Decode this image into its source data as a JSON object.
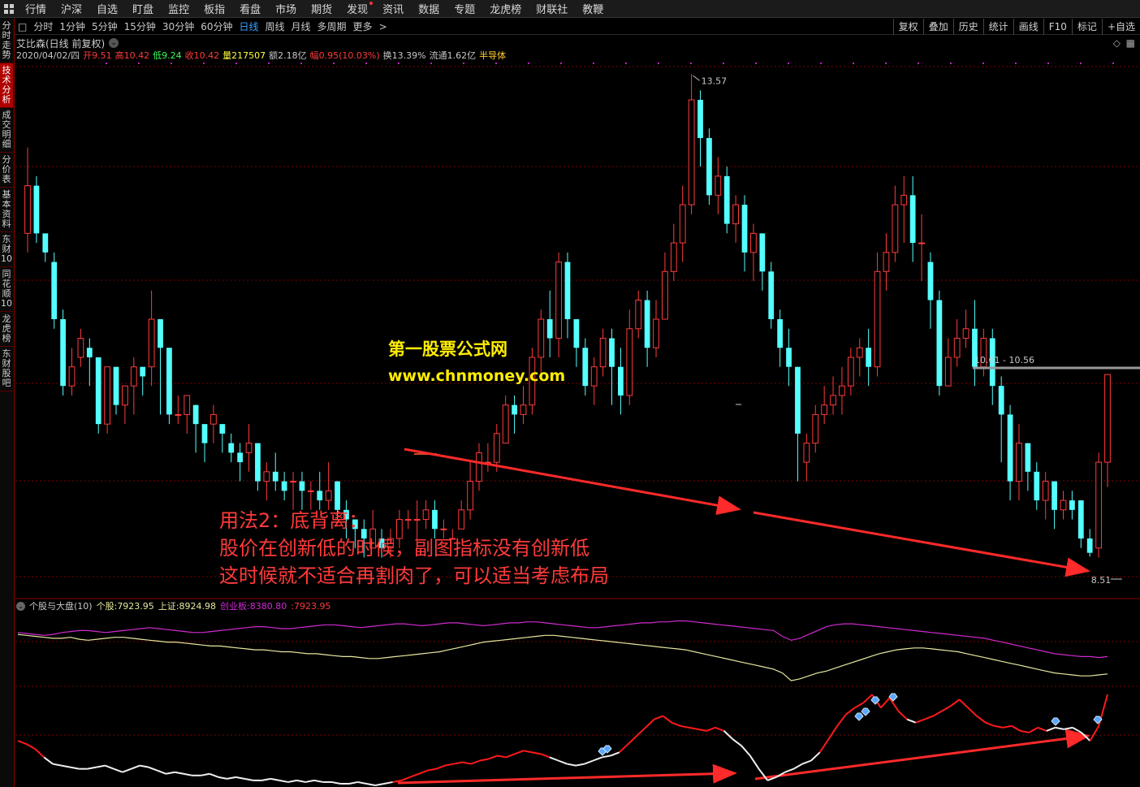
{
  "nav": {
    "items": [
      "行情",
      "沪深",
      "自选",
      "盯盘",
      "监控",
      "板指",
      "看盘",
      "市场",
      "期货",
      "发现",
      "资讯",
      "数据",
      "专题",
      "龙虎榜",
      "财联社",
      "教鞭"
    ]
  },
  "periods": {
    "items": [
      "分时",
      "1分钟",
      "5分钟",
      "15分钟",
      "30分钟",
      "60分钟",
      "日线",
      "周线",
      "月线",
      "多周期",
      "更多"
    ],
    "active": "日线"
  },
  "toolbar": {
    "items": [
      "复权",
      "叠加",
      "历史",
      "统计",
      "画线",
      "F10",
      "标记",
      "+自选"
    ]
  },
  "sidebar": {
    "items": [
      "分时走势",
      "技术分析",
      "成交明细",
      "分价表",
      "基本资料",
      "东财10",
      "同花顺10",
      "龙虎榜",
      "东财股吧"
    ],
    "active": "技术分析"
  },
  "stock": {
    "title": "艾比森(日线 前复权)",
    "date": "2020/04/02/四",
    "open_label": "开",
    "open": "9.51",
    "high_label": "高",
    "high": "10.42",
    "low_label": "低",
    "low": "9.24",
    "close_label": "收",
    "close": "10.42",
    "vol_label": "量",
    "vol": "217507",
    "amt_label": "额",
    "amt": "2.18亿",
    "chg_label": "幅",
    "chg": "0.95(10.03%)",
    "turn_label": "换",
    "turn": "13.39%",
    "float_label": "流通",
    "float": "1.62亿",
    "sector": "半导体"
  },
  "annotations": {
    "high_label": "13.57",
    "low_label": "8.51",
    "range_label": "10.61 - 10.56"
  },
  "watermark": {
    "line1": "第一股票公式网",
    "line2": "www.chnmoney.com"
  },
  "note": {
    "line1": "用法2：底背离：",
    "line2": "股价在创新低的时候，副图指标没有创新低",
    "line3": "这时候就不适合再割肉了，可以适当考虑布局"
  },
  "indicator": {
    "name": "个股与大盘(10)",
    "stock_label": "个股:",
    "stock_value": "7923.95",
    "sz_label": "上证:",
    "sz_value": "8924.98",
    "cyb_label": "创业板:",
    "cyb_value": "8380.80",
    "extra": ":7923.95"
  },
  "colors": {
    "up": "#ff3b3b",
    "down": "#54ffff",
    "grid": "#7a0000",
    "magenta": "#d02ad0",
    "yellow": "#e8e8a0",
    "note": "#ff3a3a",
    "arrow": "#ff2a2a"
  },
  "chart_data": {
    "type": "candlestick",
    "price_range": [
      8.51,
      13.57
    ],
    "candles": [
      [
        11.9,
        12.4,
        12.8,
        11.7
      ],
      [
        12.4,
        11.9,
        12.5,
        11.8
      ],
      [
        11.9,
        11.7,
        11.8,
        11.6
      ],
      [
        11.6,
        11.0,
        11.7,
        10.9
      ],
      [
        11.0,
        10.3,
        11.1,
        10.2
      ],
      [
        10.3,
        10.5,
        10.7,
        10.2
      ],
      [
        10.6,
        10.8,
        10.9,
        10.5
      ],
      [
        10.7,
        10.6,
        10.8,
        10.3
      ],
      [
        10.6,
        9.9,
        10.6,
        9.8
      ],
      [
        9.9,
        10.5,
        10.5,
        9.8
      ],
      [
        10.5,
        10.1,
        10.5,
        10.0
      ],
      [
        10.1,
        10.3,
        10.3,
        9.9
      ],
      [
        10.3,
        10.5,
        10.6,
        10.0
      ],
      [
        10.5,
        10.4,
        10.5,
        10.2
      ],
      [
        10.5,
        11.0,
        11.3,
        10.3
      ],
      [
        11.0,
        10.7,
        11.0,
        10.0
      ],
      [
        10.7,
        10.0,
        10.7,
        9.9
      ],
      [
        10.0,
        10.0,
        10.2,
        9.9
      ],
      [
        10.0,
        10.2,
        10.2,
        9.8
      ],
      [
        10.1,
        9.9,
        10.1,
        9.6
      ],
      [
        9.9,
        9.7,
        9.9,
        9.5
      ],
      [
        9.9,
        10.0,
        10.1,
        9.7
      ],
      [
        9.9,
        9.8,
        9.9,
        9.6
      ],
      [
        9.7,
        9.6,
        9.8,
        9.5
      ],
      [
        9.6,
        9.5,
        9.7,
        9.3
      ],
      [
        9.6,
        9.7,
        9.9,
        9.4
      ],
      [
        9.7,
        9.3,
        9.7,
        9.2
      ],
      [
        9.3,
        9.4,
        9.5,
        9.1
      ],
      [
        9.4,
        9.3,
        9.6,
        9.2
      ],
      [
        9.3,
        9.2,
        9.4,
        9.1
      ],
      [
        9.3,
        9.3,
        9.4,
        9.0
      ],
      [
        9.3,
        9.2,
        9.4,
        9.0
      ],
      [
        9.2,
        9.2,
        9.3,
        9.0
      ],
      [
        9.2,
        9.1,
        9.4,
        9.0
      ],
      [
        9.1,
        9.2,
        9.5,
        9.0
      ],
      [
        9.3,
        9.0,
        9.3,
        8.9
      ],
      [
        9.0,
        8.9,
        9.1,
        8.7
      ],
      [
        8.9,
        8.8,
        8.9,
        8.6
      ],
      [
        8.8,
        8.7,
        8.9,
        8.5
      ],
      [
        8.6,
        8.8,
        9.0,
        8.6
      ],
      [
        8.7,
        8.6,
        8.8,
        8.5
      ],
      [
        8.6,
        8.7,
        8.8,
        8.5
      ],
      [
        8.7,
        8.9,
        9.0,
        8.6
      ],
      [
        8.9,
        8.9,
        9.0,
        8.8
      ],
      [
        8.9,
        8.9,
        9.1,
        8.6
      ],
      [
        8.9,
        9.0,
        9.1,
        8.8
      ],
      [
        9.0,
        8.8,
        9.1,
        8.7
      ],
      [
        8.8,
        8.8,
        8.9,
        8.7
      ],
      [
        8.7,
        8.7,
        8.8,
        8.7
      ],
      [
        8.8,
        9.0,
        9.1,
        8.8
      ],
      [
        9.0,
        9.3,
        9.5,
        8.9
      ],
      [
        9.3,
        9.6,
        9.7,
        9.2
      ],
      [
        9.5,
        9.5,
        9.7,
        9.4
      ],
      [
        9.5,
        9.8,
        9.9,
        9.4
      ],
      [
        9.7,
        10.1,
        10.2,
        9.7
      ],
      [
        10.1,
        10.0,
        10.2,
        9.8
      ],
      [
        10.0,
        10.1,
        10.3,
        9.9
      ],
      [
        10.1,
        10.6,
        10.7,
        10.0
      ],
      [
        10.6,
        11.0,
        11.1,
        10.4
      ],
      [
        11.0,
        10.8,
        11.3,
        10.6
      ],
      [
        10.8,
        11.6,
        11.7,
        10.6
      ],
      [
        11.6,
        11.0,
        11.7,
        10.8
      ],
      [
        11.0,
        10.7,
        11.0,
        10.5
      ],
      [
        10.7,
        10.3,
        10.8,
        10.2
      ],
      [
        10.3,
        10.5,
        10.6,
        10.1
      ],
      [
        10.5,
        10.8,
        10.9,
        10.4
      ],
      [
        10.8,
        10.5,
        10.9,
        10.1
      ],
      [
        10.5,
        10.2,
        10.7,
        10.0
      ],
      [
        10.2,
        10.9,
        11.1,
        10.1
      ],
      [
        10.9,
        11.2,
        11.3,
        10.8
      ],
      [
        11.2,
        10.7,
        11.3,
        10.5
      ],
      [
        10.7,
        11.0,
        11.2,
        10.6
      ],
      [
        11.0,
        11.5,
        11.7,
        11.0
      ],
      [
        11.5,
        11.8,
        12.0,
        11.4
      ],
      [
        11.8,
        12.2,
        12.4,
        11.6
      ],
      [
        12.2,
        13.3,
        13.57,
        12.1
      ],
      [
        13.3,
        12.9,
        13.4,
        12.6
      ],
      [
        12.9,
        12.3,
        13.0,
        12.2
      ],
      [
        12.3,
        12.5,
        12.7,
        12.1
      ],
      [
        12.5,
        12.0,
        12.6,
        11.9
      ],
      [
        12.0,
        12.2,
        12.3,
        11.8
      ],
      [
        12.2,
        11.7,
        12.3,
        11.5
      ],
      [
        11.7,
        11.9,
        12.0,
        11.4
      ],
      [
        11.9,
        11.5,
        11.9,
        11.3
      ],
      [
        11.5,
        11.0,
        11.6,
        10.9
      ],
      [
        11.0,
        10.7,
        11.1,
        10.5
      ],
      [
        10.7,
        10.5,
        10.9,
        10.3
      ],
      [
        10.5,
        9.8,
        10.5,
        9.3
      ],
      [
        9.5,
        9.7,
        9.8,
        9.3
      ],
      [
        9.7,
        10.0,
        10.1,
        9.6
      ],
      [
        10.0,
        10.1,
        10.3,
        9.9
      ],
      [
        10.1,
        10.2,
        10.4,
        10.0
      ],
      [
        10.2,
        10.3,
        10.5,
        10.0
      ],
      [
        10.3,
        10.6,
        10.7,
        10.2
      ],
      [
        10.6,
        10.7,
        10.8,
        10.4
      ],
      [
        10.7,
        10.5,
        10.9,
        10.3
      ],
      [
        10.5,
        11.5,
        11.7,
        10.4
      ],
      [
        11.5,
        11.7,
        11.9,
        11.3
      ],
      [
        11.7,
        12.2,
        12.4,
        11.6
      ],
      [
        12.2,
        12.3,
        12.5,
        11.8
      ],
      [
        12.3,
        11.8,
        12.5,
        11.6
      ],
      [
        11.8,
        11.8,
        12.1,
        11.4
      ],
      [
        11.6,
        11.2,
        11.7,
        10.9
      ],
      [
        11.2,
        10.3,
        11.3,
        10.2
      ],
      [
        10.3,
        10.6,
        10.8,
        10.3
      ],
      [
        10.6,
        10.8,
        11.0,
        10.5
      ],
      [
        10.8,
        10.9,
        11.1,
        10.7
      ],
      [
        10.9,
        10.5,
        11.2,
        10.3
      ],
      [
        10.5,
        10.8,
        10.9,
        10.4
      ],
      [
        10.8,
        10.3,
        10.9,
        10.1
      ],
      [
        10.3,
        10.0,
        10.4,
        9.5
      ],
      [
        10.0,
        9.3,
        10.1,
        9.1
      ],
      [
        9.3,
        9.7,
        9.9,
        9.1
      ],
      [
        9.7,
        9.4,
        9.7,
        9.2
      ],
      [
        9.4,
        9.1,
        9.5,
        9.0
      ],
      [
        9.1,
        9.3,
        9.4,
        8.9
      ],
      [
        9.3,
        9.0,
        9.3,
        8.8
      ],
      [
        9.0,
        9.1,
        9.2,
        8.9
      ],
      [
        9.1,
        9.0,
        9.2,
        8.9
      ],
      [
        9.1,
        8.7,
        9.1,
        8.6
      ],
      [
        8.7,
        8.55,
        8.8,
        8.51
      ],
      [
        8.6,
        9.5,
        9.6,
        8.5
      ],
      [
        9.5,
        10.42,
        10.42,
        9.24
      ]
    ],
    "stock_line": [
      78,
      77,
      76,
      75,
      74,
      74,
      75,
      73,
      72,
      73,
      74,
      75,
      75,
      74,
      73,
      72,
      71,
      70,
      70,
      69,
      68,
      67,
      66,
      66,
      65,
      64,
      63,
      62,
      62,
      61,
      60,
      60,
      59,
      58,
      58,
      57,
      56,
      55,
      55,
      54,
      53,
      53,
      54,
      55,
      56,
      57,
      58,
      59,
      60,
      62,
      64,
      66,
      68,
      70,
      71,
      72,
      73,
      74,
      75,
      76,
      77,
      77,
      76,
      75,
      74,
      73,
      72,
      71,
      70,
      69,
      68,
      67,
      66,
      65,
      64,
      63,
      62,
      60,
      58,
      56,
      54,
      52,
      50,
      48,
      46,
      44,
      42,
      38,
      30,
      32,
      35,
      38,
      40,
      43,
      46,
      49,
      52,
      55,
      58,
      60,
      62,
      63,
      64,
      64,
      63,
      62,
      61,
      60,
      58,
      56,
      54,
      52,
      50,
      48,
      46,
      44,
      42,
      40,
      38,
      37,
      36,
      35,
      35,
      36,
      37
    ],
    "index_line": [
      80,
      79,
      78,
      77,
      78,
      80,
      81,
      82,
      82,
      81,
      80,
      81,
      82,
      83,
      84,
      85,
      84,
      83,
      82,
      81,
      80,
      80,
      81,
      82,
      83,
      84,
      85,
      86,
      86,
      85,
      84,
      84,
      85,
      86,
      87,
      88,
      88,
      87,
      86,
      85,
      86,
      87,
      88,
      89,
      89,
      88,
      87,
      88,
      89,
      90,
      90,
      89,
      88,
      87,
      88,
      89,
      90,
      90,
      91,
      91,
      90,
      89,
      88,
      87,
      86,
      85,
      85,
      86,
      87,
      88,
      89,
      90,
      90,
      91,
      91,
      92,
      92,
      91,
      90,
      89,
      88,
      87,
      86,
      85,
      84,
      83,
      82,
      76,
      72,
      74,
      78,
      82,
      86,
      88,
      89,
      89,
      88,
      87,
      86,
      85,
      84,
      83,
      82,
      81,
      80,
      79,
      78,
      77,
      76,
      75,
      74,
      72,
      70,
      68,
      66,
      64,
      62,
      60,
      58,
      57,
      56,
      55,
      55,
      54,
      55
    ],
    "osc_line": [
      [
        0.27,
        "up"
      ],
      [
        0.25,
        "up"
      ],
      [
        0.22,
        "up"
      ],
      [
        0.17,
        "up"
      ],
      [
        0.13,
        "dn"
      ],
      [
        0.12,
        "dn"
      ],
      [
        0.11,
        "dn"
      ],
      [
        0.1,
        "dn"
      ],
      [
        0.1,
        "dn"
      ],
      [
        0.11,
        "dn"
      ],
      [
        0.12,
        "dn"
      ],
      [
        0.1,
        "dn"
      ],
      [
        0.08,
        "dn"
      ],
      [
        0.1,
        "dn"
      ],
      [
        0.12,
        "dn"
      ],
      [
        0.11,
        "dn"
      ],
      [
        0.09,
        "dn"
      ],
      [
        0.07,
        "dn"
      ],
      [
        0.08,
        "dn"
      ],
      [
        0.07,
        "dn"
      ],
      [
        0.06,
        "dn"
      ],
      [
        0.06,
        "dn"
      ],
      [
        0.07,
        "dn"
      ],
      [
        0.05,
        "dn"
      ],
      [
        0.04,
        "dn"
      ],
      [
        0.05,
        "dn"
      ],
      [
        0.04,
        "dn"
      ],
      [
        0.03,
        "dn"
      ],
      [
        0.03,
        "dn"
      ],
      [
        0.04,
        "dn"
      ],
      [
        0.03,
        "dn"
      ],
      [
        0.02,
        "dn"
      ],
      [
        0.03,
        "dn"
      ],
      [
        0.02,
        "dn"
      ],
      [
        0.03,
        "dn"
      ],
      [
        0.02,
        "dn"
      ],
      [
        0.02,
        "dn"
      ],
      [
        0.01,
        "dn"
      ],
      [
        0.01,
        "dn"
      ],
      [
        0.02,
        "dn"
      ],
      [
        0.01,
        "dn"
      ],
      [
        0.0,
        "dn"
      ],
      [
        0.01,
        "dn"
      ],
      [
        0.02,
        "dn"
      ],
      [
        0.03,
        "up"
      ],
      [
        0.05,
        "up"
      ],
      [
        0.07,
        "up"
      ],
      [
        0.09,
        "up"
      ],
      [
        0.1,
        "up"
      ],
      [
        0.12,
        "up"
      ],
      [
        0.13,
        "up"
      ],
      [
        0.14,
        "up"
      ],
      [
        0.13,
        "up"
      ],
      [
        0.15,
        "up"
      ],
      [
        0.16,
        "up"
      ],
      [
        0.18,
        "up"
      ],
      [
        0.17,
        "up"
      ],
      [
        0.19,
        "up"
      ],
      [
        0.21,
        "up"
      ],
      [
        0.2,
        "up"
      ],
      [
        0.19,
        "up"
      ],
      [
        0.17,
        "up"
      ],
      [
        0.15,
        "dn"
      ],
      [
        0.13,
        "dn"
      ],
      [
        0.12,
        "dn"
      ],
      [
        0.13,
        "dn"
      ],
      [
        0.15,
        "dn"
      ],
      [
        0.17,
        "dn"
      ],
      [
        0.18,
        "dn"
      ],
      [
        0.2,
        "dn"
      ],
      [
        0.25,
        "up"
      ],
      [
        0.3,
        "up"
      ],
      [
        0.35,
        "up"
      ],
      [
        0.4,
        "up"
      ],
      [
        0.42,
        "up"
      ],
      [
        0.38,
        "up"
      ],
      [
        0.36,
        "up"
      ],
      [
        0.35,
        "up"
      ],
      [
        0.34,
        "up"
      ],
      [
        0.33,
        "up"
      ],
      [
        0.35,
        "up"
      ],
      [
        0.33,
        "up"
      ],
      [
        0.28,
        "dn"
      ],
      [
        0.24,
        "dn"
      ],
      [
        0.18,
        "dn"
      ],
      [
        0.1,
        "dn"
      ],
      [
        0.03,
        "dn"
      ],
      [
        0.05,
        "dn"
      ],
      [
        0.08,
        "dn"
      ],
      [
        0.1,
        "dn"
      ],
      [
        0.13,
        "dn"
      ],
      [
        0.15,
        "dn"
      ],
      [
        0.2,
        "dn"
      ],
      [
        0.28,
        "up"
      ],
      [
        0.36,
        "up"
      ],
      [
        0.43,
        "up"
      ],
      [
        0.47,
        "up"
      ],
      [
        0.5,
        "up"
      ],
      [
        0.55,
        "up"
      ],
      [
        0.47,
        "up"
      ],
      [
        0.53,
        "up"
      ],
      [
        0.45,
        "up"
      ],
      [
        0.4,
        "up"
      ],
      [
        0.38,
        "dn"
      ],
      [
        0.4,
        "up"
      ],
      [
        0.42,
        "up"
      ],
      [
        0.45,
        "up"
      ],
      [
        0.48,
        "up"
      ],
      [
        0.52,
        "up"
      ],
      [
        0.47,
        "up"
      ],
      [
        0.42,
        "up"
      ],
      [
        0.38,
        "up"
      ],
      [
        0.36,
        "up"
      ],
      [
        0.35,
        "up"
      ],
      [
        0.36,
        "up"
      ],
      [
        0.33,
        "up"
      ],
      [
        0.32,
        "up"
      ],
      [
        0.35,
        "up"
      ],
      [
        0.33,
        "up"
      ],
      [
        0.35,
        "dn"
      ],
      [
        0.34,
        "dn"
      ],
      [
        0.35,
        "dn"
      ],
      [
        0.32,
        "dn"
      ],
      [
        0.27,
        "dn"
      ],
      [
        0.36,
        "up"
      ],
      [
        0.55,
        "up"
      ]
    ]
  }
}
